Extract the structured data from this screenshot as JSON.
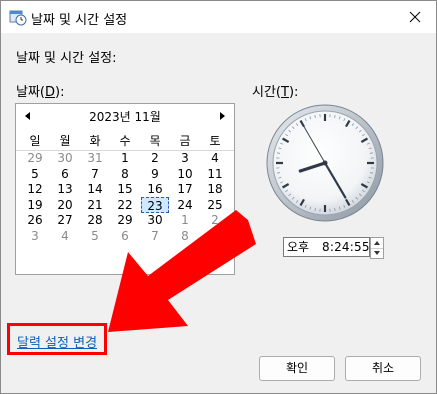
{
  "window": {
    "title": "날짜 및 시간 설정"
  },
  "heading": "날짜 및 시간 설정:",
  "date_label": {
    "prefix": "날짜(",
    "mnemonic": "D",
    "suffix": "):"
  },
  "time_label": {
    "prefix": "시간(",
    "mnemonic": "T",
    "suffix": "):"
  },
  "calendar": {
    "month": "2023년 11월",
    "weekdays": [
      "일",
      "월",
      "화",
      "수",
      "목",
      "금",
      "토"
    ],
    "weeks": [
      [
        "29",
        "30",
        "31",
        "1",
        "2",
        "3",
        "4"
      ],
      [
        "5",
        "6",
        "7",
        "8",
        "9",
        "10",
        "11"
      ],
      [
        "12",
        "13",
        "14",
        "15",
        "16",
        "17",
        "18"
      ],
      [
        "19",
        "20",
        "21",
        "22",
        "23",
        "24",
        "25"
      ],
      [
        "26",
        "27",
        "28",
        "29",
        "30",
        "1",
        "2"
      ],
      [
        "3",
        "4",
        "5",
        "6",
        "7",
        "8",
        "9"
      ]
    ],
    "selected_date": "23"
  },
  "time": {
    "ampm": "오후",
    "value": "8:24:55"
  },
  "clock": {
    "hour": 8,
    "minute": 24,
    "second": 55
  },
  "link": {
    "label": "달력 설정 변경"
  },
  "buttons": {
    "ok": "확인",
    "cancel": "취소"
  },
  "colors": {
    "highlight": "#ff0000",
    "link": "#0c5fb6",
    "selection": "#cde8ff"
  }
}
